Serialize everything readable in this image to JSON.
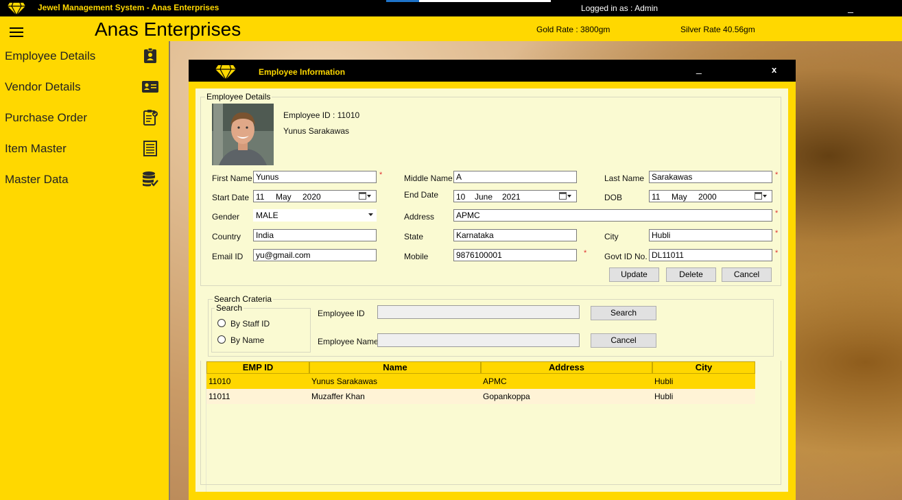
{
  "window": {
    "title": "Jewel Management System - Anas Enterprises",
    "logged_in": "Logged in as : Admin",
    "minimize": "_",
    "top_progress": 0.2
  },
  "header": {
    "company": "Anas Enterprises",
    "gold_rate": "Gold Rate :  3800gm",
    "silver_rate": "Silver Rate 40.56gm"
  },
  "sidebar": {
    "items": [
      {
        "label": "Employee Details",
        "icon": "id-badge-icon"
      },
      {
        "label": "Vendor Details",
        "icon": "contact-card-icon"
      },
      {
        "label": "Purchase Order",
        "icon": "clipboard-check-icon"
      },
      {
        "label": "Item Master",
        "icon": "list-document-icon"
      },
      {
        "label": "Master Data",
        "icon": "database-check-icon"
      }
    ]
  },
  "dialog": {
    "title": "Employee Information",
    "minimize": "_",
    "close": "x",
    "details_group": "Employee Details",
    "employee_id_text": "Employee ID : 11010",
    "employee_name_text": "Yunus Sarakawas",
    "fields": {
      "first_name_label": "First Name",
      "first_name": "Yunus",
      "middle_name_label": "Middle Name",
      "middle_name": "A",
      "last_name_label": "Last Name",
      "last_name": "Sarakawas",
      "start_date_label": "Start Date",
      "start_day": "11",
      "start_month": "May",
      "start_year": "2020",
      "end_date_label": "End Date",
      "end_day": "10",
      "end_month": "June",
      "end_year": "2021",
      "dob_label": "DOB",
      "dob_day": "11",
      "dob_month": "May",
      "dob_year": "2000",
      "gender_label": "Gender",
      "gender": "MALE",
      "address_label": "Address",
      "address": "APMC",
      "country_label": "Country",
      "country": "India",
      "state_label": "State",
      "state": "Karnataka",
      "city_label": "City",
      "city": "Hubli",
      "email_label": "Email ID",
      "email": "yu@gmail.com",
      "mobile_label": "Mobile",
      "mobile": "9876100001",
      "govt_id_label": "Govt ID No.",
      "govt_id": "DL11011",
      "required_mark": "*"
    },
    "buttons": {
      "update": "Update",
      "delete": "Delete",
      "cancel": "Cancel"
    },
    "search": {
      "group": "Search Crateria",
      "sub_group": "Search",
      "by_staff_id": "By Staff ID",
      "by_name": "By Name",
      "employee_id_label": "Employee ID",
      "employee_name_label": "Employee Name",
      "employee_id_value": "",
      "employee_name_value": "",
      "search_btn": "Search",
      "cancel_btn": "Cancel"
    },
    "grid": {
      "columns": [
        "EMP ID",
        "Name",
        "Address",
        "City"
      ],
      "rows": [
        [
          "11010",
          "Yunus Sarakawas",
          "APMC",
          "Hubli"
        ],
        [
          "11011",
          "Muzaffer Khan",
          "Gopankoppa",
          "Hubli"
        ]
      ]
    }
  },
  "colors": {
    "accent": "#ffd800",
    "title_bar": "#000000",
    "form_bg": "#fafad2",
    "selected_row": "#ffd700",
    "alt_row": "#fff3d6"
  }
}
